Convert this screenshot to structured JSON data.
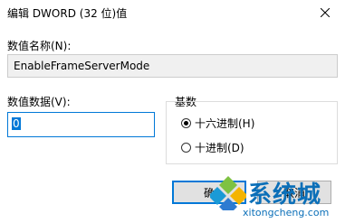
{
  "window": {
    "title": "编辑 DWORD (32 位)值"
  },
  "value_name": {
    "label": "数值名称(N):",
    "value": "EnableFrameServerMode"
  },
  "value_data": {
    "label": "数值数据(V):",
    "value": "0"
  },
  "base": {
    "label": "基数",
    "options": [
      {
        "label": "十六进制(H)",
        "checked": true
      },
      {
        "label": "十进制(D)",
        "checked": false
      }
    ]
  },
  "buttons": {
    "ok_label": "确",
    "cancel_label": "取消"
  },
  "watermark": {
    "text": "系统城",
    "url": "xitongcheng.com"
  },
  "colors": {
    "accent": "#0078d7",
    "watermark": "#0b6fb8"
  }
}
